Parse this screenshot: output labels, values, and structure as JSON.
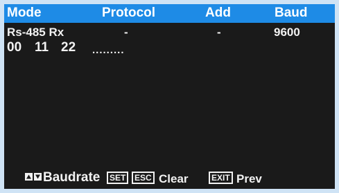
{
  "header": {
    "mode": "Mode",
    "protocol": "Protocol",
    "add": "Add",
    "baud": "Baud"
  },
  "status_row": {
    "mode": "Rs-485 Rx",
    "protocol": "-",
    "add": "-",
    "baud": "9600"
  },
  "data_row": {
    "bytes": [
      "00",
      "11",
      "22"
    ],
    "ellipsis": "........."
  },
  "footer": {
    "baudrate_label": "Baudrate",
    "set_key": "SET",
    "esc_key": "ESC",
    "clear_label": "Clear",
    "exit_key": "EXIT",
    "prev_label": "Prev"
  },
  "colors": {
    "header_bg": "#1e8be6",
    "screen_bg": "#1a1a1a",
    "text": "#f2f2f2"
  }
}
